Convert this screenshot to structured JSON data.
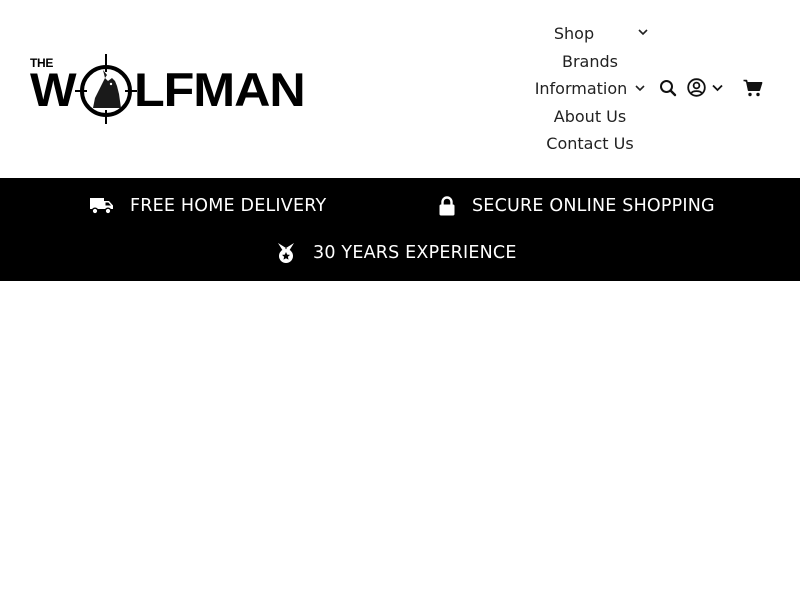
{
  "brand": {
    "logo_prefix": "THE",
    "logo_text": "WOLFMAN",
    "logo_w": "W",
    "logo_rest": "LFMAN"
  },
  "nav": {
    "items": [
      {
        "label": "Shop",
        "has_dropdown": true
      },
      {
        "label": "Brands",
        "has_dropdown": false
      },
      {
        "label": "Information",
        "has_dropdown": true
      },
      {
        "label": "About Us",
        "has_dropdown": false
      },
      {
        "label": "Contact Us",
        "has_dropdown": false
      }
    ]
  },
  "header_icons": {
    "search": "search-icon",
    "account": "account-icon",
    "account_menu": "chevron-down-icon",
    "cart": "cart-icon"
  },
  "features": [
    {
      "icon": "truck-icon",
      "label": "FREE HOME DELIVERY"
    },
    {
      "icon": "lock-icon",
      "label": "SECURE ONLINE SHOPPING"
    },
    {
      "icon": "medal-icon",
      "label": "30 YEARS EXPERIENCE"
    }
  ],
  "colors": {
    "banner_background": "#000000",
    "banner_text": "#ffffff",
    "page_background": "#ffffff",
    "text": "#111111"
  }
}
